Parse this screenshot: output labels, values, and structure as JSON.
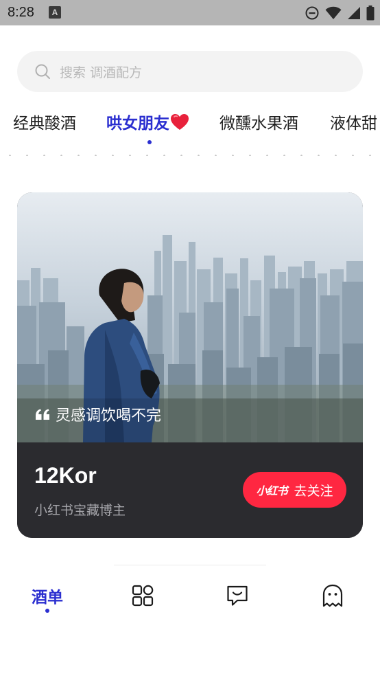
{
  "status_bar": {
    "time": "8:28",
    "notification_badge": "A",
    "icons": [
      "do-not-disturb-icon",
      "wifi-icon",
      "signal-icon",
      "battery-icon"
    ]
  },
  "search": {
    "placeholder": "搜索 调酒配方"
  },
  "tabs": [
    {
      "label": "经典酸酒",
      "active": false
    },
    {
      "label": "哄女朋友",
      "active": true,
      "emoji_icon": "heart-icon"
    },
    {
      "label": "微醺水果酒",
      "active": false
    },
    {
      "label": "液体甜",
      "active": false
    }
  ],
  "card": {
    "quote": "灵感调饮喝不完",
    "author_name": "12Kor",
    "author_desc": "小红书宝藏博主",
    "follow_button": {
      "brand": "小红书",
      "label": "去关注"
    }
  },
  "bottom_nav": [
    {
      "label": "酒单",
      "icon": "cocktail-list",
      "active": true
    },
    {
      "label": "",
      "icon": "grid-icon",
      "active": false
    },
    {
      "label": "",
      "icon": "message-icon",
      "active": false
    },
    {
      "label": "",
      "icon": "ghost-icon",
      "active": false
    }
  ],
  "colors": {
    "accent": "#2b2fd0",
    "brand_red": "#ff2741",
    "card_dark": "#2b2b2f",
    "search_bg": "#f3f3f3"
  }
}
